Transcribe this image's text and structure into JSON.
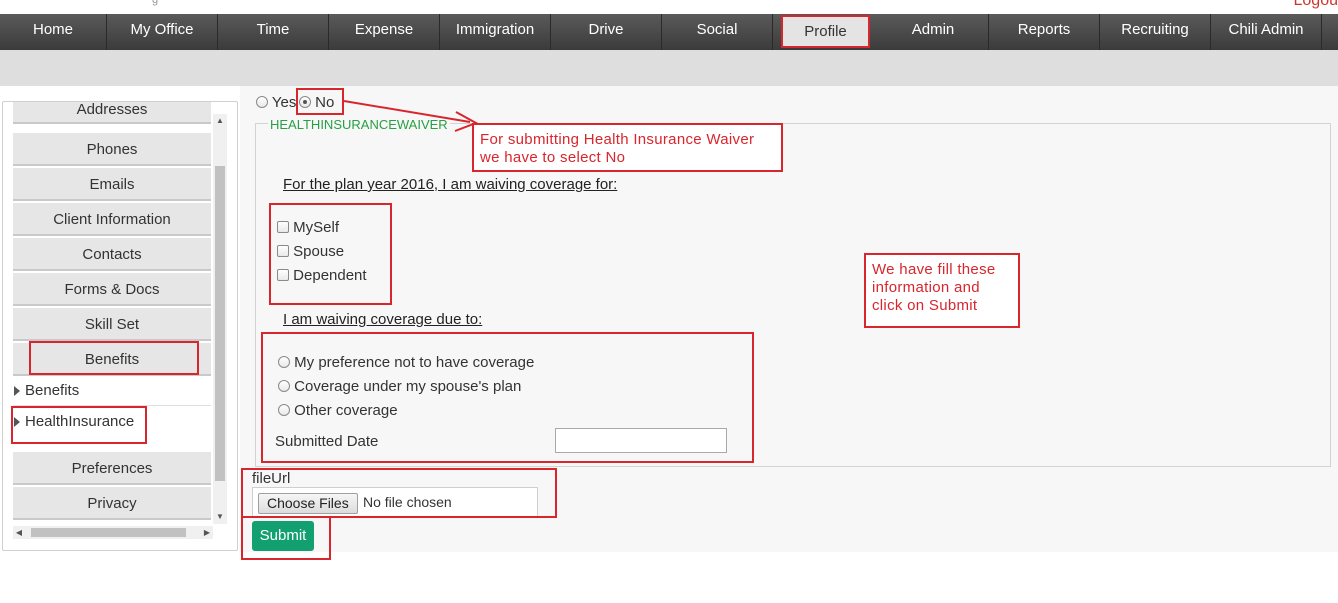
{
  "header": {
    "tiny_text": "g",
    "logout_label": "Logou"
  },
  "nav": {
    "items": [
      "Home",
      "My Office",
      "Time",
      "Expense",
      "Immigration",
      "Drive",
      "Social",
      "Profile",
      "Admin",
      "Reports",
      "Recruiting",
      "Chili Admin"
    ],
    "active": "Profile"
  },
  "sidebar": {
    "buttons": [
      "Addresses",
      "Phones",
      "Emails",
      "Client Information",
      "Contacts",
      "Forms & Docs",
      "Skill Set",
      "Benefits"
    ],
    "tree_items": [
      "Benefits",
      "HealthInsurance"
    ],
    "lower_buttons": [
      "Preferences",
      "Privacy"
    ]
  },
  "form": {
    "radio_yes": "Yes",
    "radio_no": "No",
    "legend": "HEALTHINSURANCEWAIVER",
    "plan_heading": "For the plan year 2016, I am waiving coverage for:",
    "coverage_options": [
      "MySelf",
      "Spouse",
      "Dependent"
    ],
    "reason_heading": "I am waiving coverage due to:",
    "reason_options": [
      "My preference not to have coverage",
      "Coverage under my spouse's plan",
      "Other coverage"
    ],
    "submitted_date_label": "Submitted Date",
    "submitted_date_value": "",
    "file_label": "fileUrl",
    "choose_files_label": "Choose Files",
    "no_file_text": "No file chosen",
    "submit_label": "Submit"
  },
  "annotations": {
    "note_no_line1": "For submitting Health Insurance Waiver",
    "note_no_line2": "we have to select No",
    "note_fill_line1": "We have fill these",
    "note_fill_line2": "information and",
    "note_fill_line3": "click on Submit"
  },
  "colors": {
    "accent_red": "#d8262d",
    "legend_green": "#27a045",
    "submit_green": "#12a070",
    "nav_dark": "#4a4a4a"
  }
}
